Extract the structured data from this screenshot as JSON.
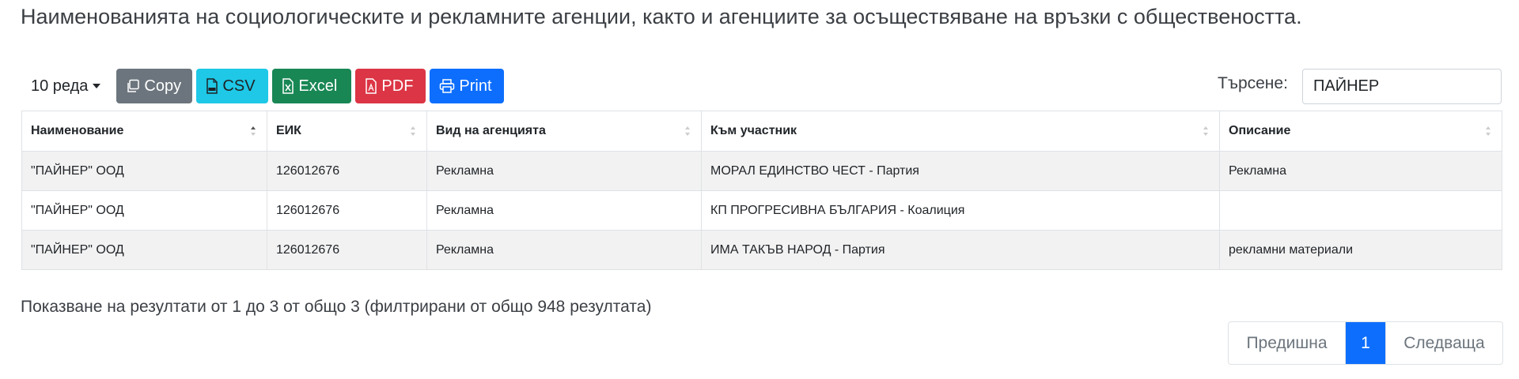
{
  "page": {
    "title": "Наименованията на социологическите и рекламните агенции, както и агенциите за осъществяване на връзки с обществеността."
  },
  "toolbar": {
    "length_label": "10 реда",
    "buttons": {
      "copy": "Copy",
      "csv": "CSV",
      "excel": "Excel",
      "pdf": "PDF",
      "print": "Print"
    },
    "button_colors": {
      "copy": "#6c757d",
      "csv": "#1ec8e6",
      "excel": "#198754",
      "pdf": "#dc3545",
      "print": "#0d6efd"
    }
  },
  "search": {
    "label": "Търсене:",
    "value": "ПАЙНЕР"
  },
  "table": {
    "columns": [
      "Наименование",
      "ЕИК",
      "Вид на агенцията",
      "Към участник",
      "Описание"
    ],
    "sorted_column": "Наименование",
    "rows": [
      [
        "\"ПАЙНЕР\" ООД",
        "126012676",
        "Рекламна",
        "МОРАЛ ЕДИНСТВО ЧЕСТ - Партия",
        "Рекламна"
      ],
      [
        "\"ПАЙНЕР\" ООД",
        "126012676",
        "Рекламна",
        "КП ПРОГРЕСИВНА БЪЛГАРИЯ - Коалиция",
        ""
      ],
      [
        "\"ПАЙНЕР\" ООД",
        "126012676",
        "Рекламна",
        "ИМА ТАКЪВ НАРОД - Партия",
        "рекламни материали"
      ]
    ]
  },
  "info": {
    "text": "Показване на резултати от 1 до 3 от общо 3 (филтрирани от общо 948 резултата)"
  },
  "pagination": {
    "prev": "Предишна",
    "current": "1",
    "next": "Следваща",
    "active_color": "#0d6efd"
  }
}
